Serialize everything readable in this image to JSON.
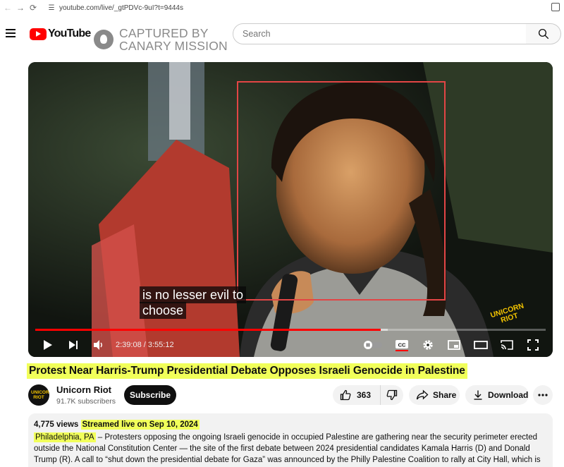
{
  "browser": {
    "url": "youtube.com/live/_gtPDVc-9uI?t=9444s"
  },
  "header": {
    "logo_text": "YouTube",
    "watermark_line1": "CAPTURED BY",
    "watermark_line2": "CANARY MISSION",
    "search_placeholder": "Search"
  },
  "player": {
    "caption_line1": "is no lesser evil to",
    "caption_line2": "choose",
    "current_time": "2:39:08",
    "duration": "3:55:12",
    "time_display": "2:39:08 / 3:55:12",
    "progress_fraction": 0.677,
    "buffered_fraction": 0.69,
    "badge_line1": "UNICORN",
    "badge_line2": "RIOT",
    "icons": [
      "play-icon",
      "next-icon",
      "volume-icon",
      "autoplay-toggle-icon",
      "cc-icon",
      "settings-icon",
      "miniplayer-icon",
      "theater-icon",
      "cast-icon",
      "fullscreen-icon"
    ],
    "accent_color": "#ff0000",
    "annotation_color": "#e34545"
  },
  "video": {
    "title": "Protest Near Harris-Trump Presidential Debate Opposes Israeli Genocide in Palestine",
    "highlight_color": "#f1ff5a"
  },
  "channel": {
    "avatar_text": "UNICORN RIOT",
    "name": "Unicorn Riot",
    "subscribers": "91.7K subscribers",
    "subscribe_label": "Subscribe"
  },
  "actions": {
    "like_count": "363",
    "share_label": "Share",
    "download_label": "Download"
  },
  "description": {
    "views": "4,775 views",
    "streamed": "Streamed live on Sep 10, 2024",
    "location": "Philadelphia, PA",
    "text": " – Protesters opposing the ongoing Israeli genocide in occupied Palestine are gathering near the security perimeter erected outside the National Constitution Center — the site of the first debate between 2024 presidential candidates Kamala Harris (D) and Donald Trump (R). A call to “shut down the presidential debate for Gaza” was announced by the Philly Palestine Coalition to rally at City Hall, which is east of the debate site."
  }
}
